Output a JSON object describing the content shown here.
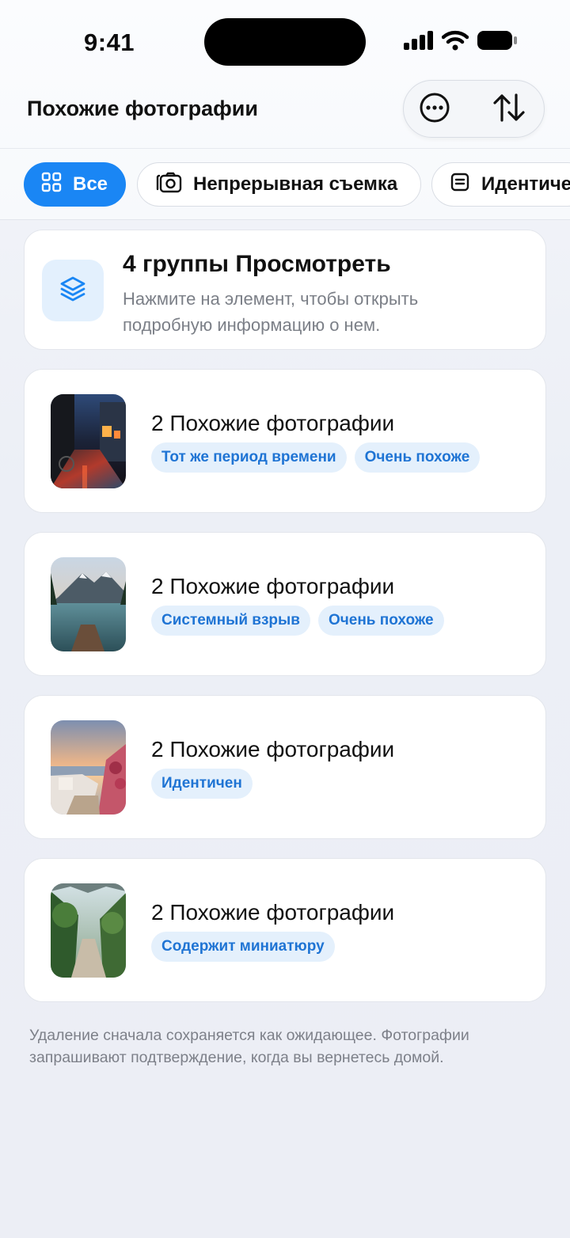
{
  "status_bar": {
    "time": "9:41"
  },
  "header": {
    "title": "Похожие фотографии",
    "more_icon": "ellipsis-circle-icon",
    "sort_icon": "arrow-up-down-icon"
  },
  "filters": [
    {
      "label": "Все",
      "icon": "grid-icon",
      "active": true
    },
    {
      "label": "Непрерывная съемка",
      "icon": "camera-burst-icon",
      "active": false
    },
    {
      "label": "Идентичен",
      "icon": "document-icon",
      "active": false
    }
  ],
  "summary": {
    "icon": "layers-icon",
    "title": "4 группы Просмотреть",
    "description": "Нажмите на элемент, чтобы открыть подробную информацию о нем."
  },
  "groups": [
    {
      "title": "2 Похожие фотографии",
      "tags": [
        "Тот же период времени",
        "Очень похоже"
      ],
      "thumbnail": "rainy-city-street"
    },
    {
      "title": "2 Похожие фотографии",
      "tags": [
        "Системный взрыв",
        "Очень похоже"
      ],
      "thumbnail": "mountain-lake-pier"
    },
    {
      "title": "2 Похожие фотографии",
      "tags": [
        "Идентичен"
      ],
      "thumbnail": "seaside-village-sunset"
    },
    {
      "title": "2 Похожие фотографии",
      "tags": [
        "Содержит миниатюру"
      ],
      "thumbnail": "greenhouse-path"
    }
  ],
  "footnote": "Удаление сначала сохраняется как ожидающее. Фотографии запрашивают подтверждение, когда вы вернетесь домой.",
  "colors": {
    "accent": "#1a86f4",
    "tag_bg": "#e4f0fc",
    "tag_text": "#1f74d4"
  }
}
